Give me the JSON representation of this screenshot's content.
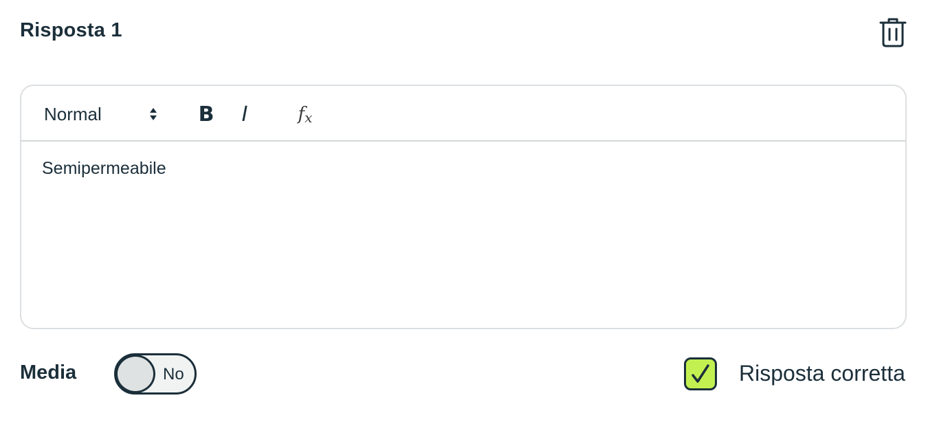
{
  "answer": {
    "title": "Risposta 1"
  },
  "toolbar": {
    "format_value": "Normal",
    "bold_label": "B",
    "italic_label": "I",
    "formula_main": "f",
    "formula_sub": "x"
  },
  "editor": {
    "content": "Semipermeabile"
  },
  "media": {
    "label": "Media",
    "toggle_state": "No"
  },
  "correct": {
    "label": "Risposta corretta",
    "checked": true
  },
  "colors": {
    "text": "#1b2f3a",
    "checkbox_fill": "#c2f050",
    "border": "#dcdfe1"
  },
  "icons": {
    "delete": "trash-icon",
    "select_arrows": "sort-arrows-icon",
    "check": "checkmark-icon"
  }
}
